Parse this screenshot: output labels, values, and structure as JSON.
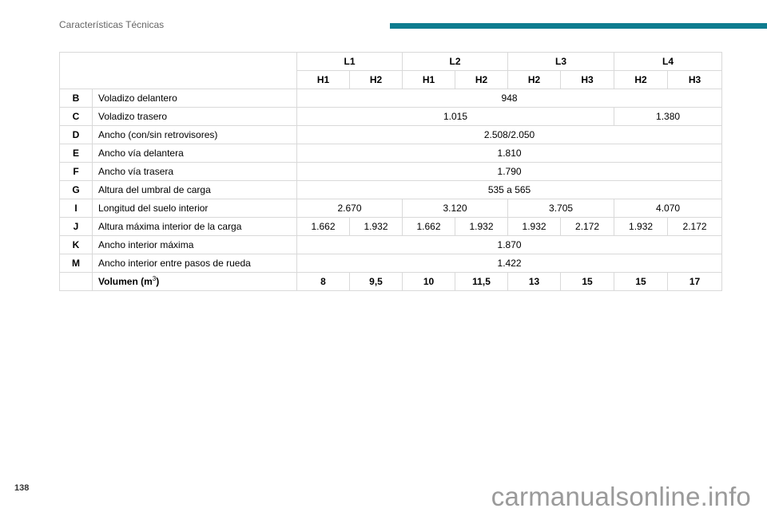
{
  "header": {
    "section_title": "Características Técnicas",
    "accent_color": "#0e7c8f"
  },
  "table": {
    "lengths": [
      "L1",
      "L2",
      "L3",
      "L4"
    ],
    "heights": [
      "H1",
      "H2",
      "H1",
      "H2",
      "H2",
      "H3",
      "H2",
      "H3"
    ],
    "rows": [
      {
        "code": "B",
        "label": "Voladizo delantero",
        "values": [
          "948"
        ]
      },
      {
        "code": "C",
        "label": "Voladizo trasero",
        "values": [
          "1.015",
          "1.380"
        ]
      },
      {
        "code": "D",
        "label": "Ancho (con/sin retrovisores)",
        "values": [
          "2.508/2.050"
        ]
      },
      {
        "code": "E",
        "label": "Ancho vía delantera",
        "values": [
          "1.810"
        ]
      },
      {
        "code": "F",
        "label": "Ancho vía trasera",
        "values": [
          "1.790"
        ]
      },
      {
        "code": "G",
        "label": "Altura del umbral de carga",
        "values": [
          "535 a 565"
        ]
      },
      {
        "code": "I",
        "label": "Longitud del suelo interior",
        "values": [
          "2.670",
          "3.120",
          "3.705",
          "4.070"
        ]
      },
      {
        "code": "J",
        "label": "Altura máxima interior de la carga",
        "values": [
          "1.662",
          "1.932",
          "1.662",
          "1.932",
          "1.932",
          "2.172",
          "1.932",
          "2.172"
        ]
      },
      {
        "code": "K",
        "label": "Ancho interior máxima",
        "values": [
          "1.870"
        ]
      },
      {
        "code": "M",
        "label": "Ancho interior entre pasos de rueda",
        "values": [
          "1.422"
        ]
      }
    ],
    "volume": {
      "label": "Volumen (m",
      "unit_superscript": "3",
      "label_close": ")",
      "values": [
        "8",
        "9,5",
        "10",
        "11,5",
        "13",
        "15",
        "15",
        "17"
      ]
    }
  },
  "footer": {
    "page_number": "138",
    "watermark": "carmanualsonline.info"
  }
}
